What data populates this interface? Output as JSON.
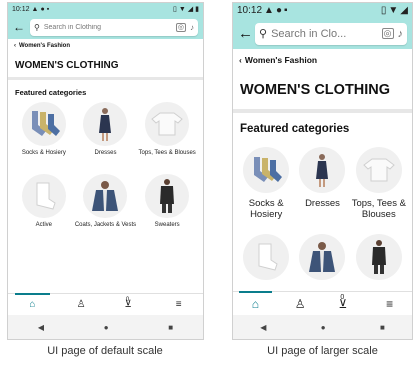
{
  "status": {
    "time": "10:12"
  },
  "search": {
    "placeholder": "Search in Clothing",
    "placeholder_truncated": "Search in Clo..."
  },
  "breadcrumb": {
    "label": "Women's Fashion"
  },
  "page": {
    "title": "WOMEN'S CLOTHING",
    "featured": "Featured categories"
  },
  "categories": [
    {
      "label": "Socks & Hosiery"
    },
    {
      "label": "Dresses"
    },
    {
      "label": "Tops, Tees & Blouses"
    },
    {
      "label": "Active"
    },
    {
      "label": "Coats, Jackets & Vests"
    },
    {
      "label": "Sweaters"
    }
  ],
  "nav": {
    "home": "home-icon",
    "account": "account-icon",
    "cart": "cart-icon",
    "menu": "menu-icon",
    "cart_count": "0"
  },
  "captions": {
    "default": "UI page of default scale",
    "larger": "UI page of larger scale"
  },
  "colors": {
    "header": "#a8e4e0",
    "accent": "#0a7d8c"
  }
}
